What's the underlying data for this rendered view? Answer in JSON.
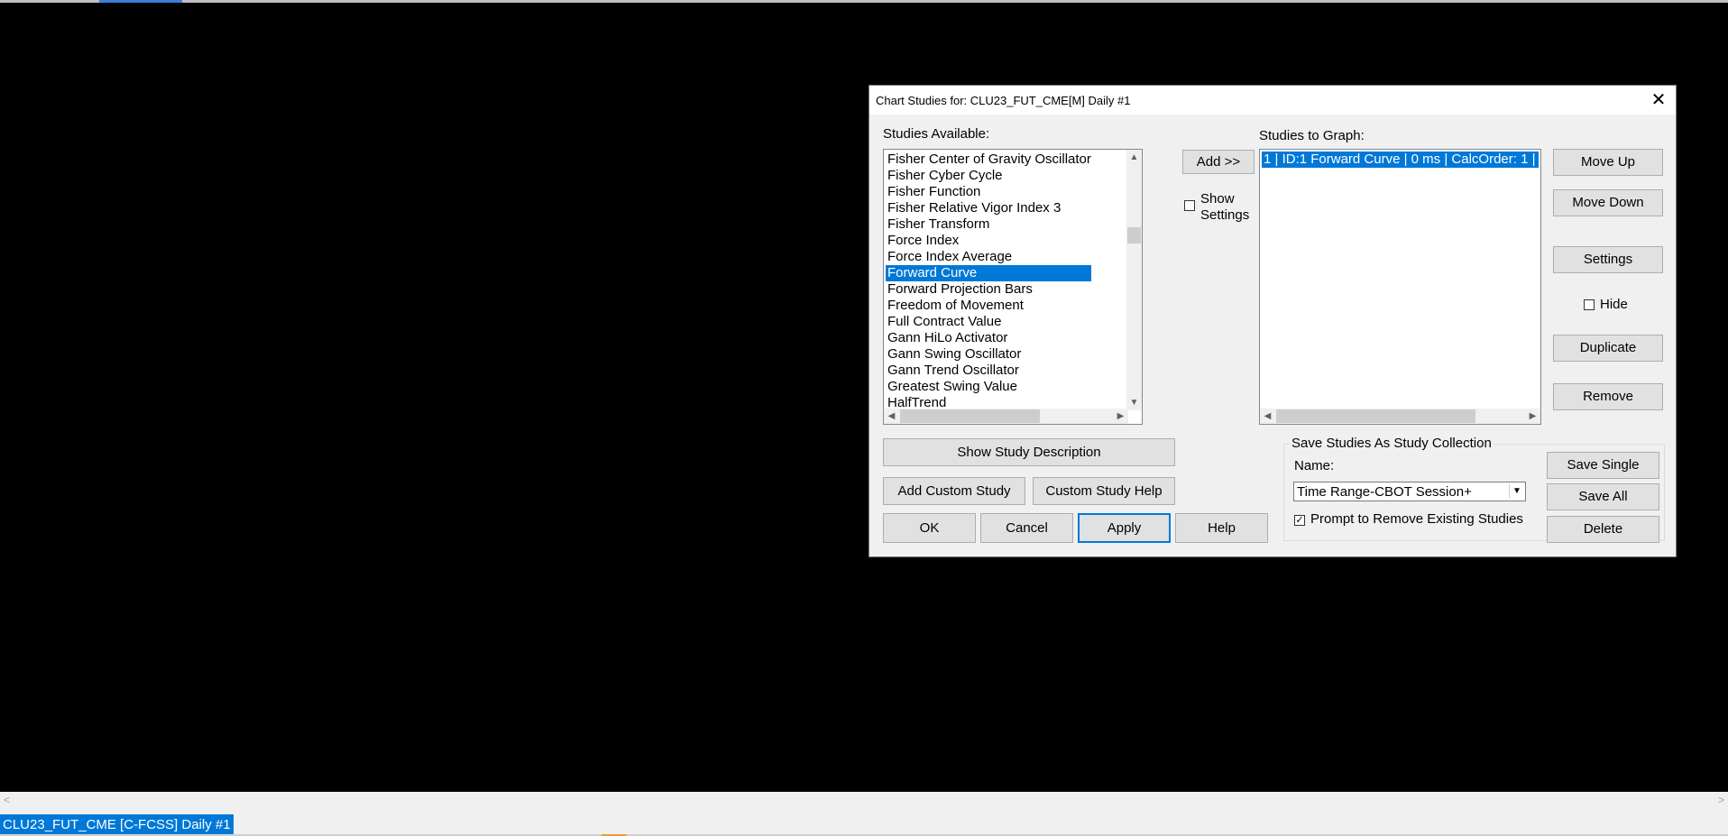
{
  "dialog": {
    "title": "Chart Studies for: CLU23_FUT_CME[M]  Daily #1",
    "close_glyph": "✕"
  },
  "available": {
    "label": "Studies Available:",
    "items": [
      "Fisher Center of Gravity Oscillator",
      "Fisher Cyber Cycle",
      "Fisher Function",
      "Fisher Relative Vigor Index 3",
      "Fisher Transform",
      "Force Index",
      "Force Index Average",
      "Forward Curve",
      "Forward Projection Bars",
      "Freedom of Movement",
      "Full Contract Value",
      "Gann HiLo Activator",
      "Gann Swing Oscillator",
      "Gann Trend Oscillator",
      "Greatest Swing Value",
      "HalfTrend"
    ],
    "selected": "Forward Curve"
  },
  "add_button": "Add >>",
  "show_settings": {
    "line1": "Show",
    "line2": "Settings"
  },
  "graph": {
    "label": "Studies to Graph:",
    "items": [
      "1 | ID:1  Forward Curve | 0 ms | CalcOrder: 1 |"
    ]
  },
  "buttons": {
    "move_up": "Move Up",
    "move_down": "Move Down",
    "settings": "Settings",
    "hide": "Hide",
    "duplicate": "Duplicate",
    "remove": "Remove",
    "show_desc": "Show Study Description",
    "add_custom": "Add Custom Study",
    "custom_help": "Custom Study Help",
    "ok": "OK",
    "cancel": "Cancel",
    "apply": "Apply",
    "help": "Help",
    "save_single": "Save Single",
    "save_all": "Save All",
    "delete": "Delete"
  },
  "collection": {
    "legend": "Save Studies As Study Collection",
    "name_label": "Name:",
    "name_value": "Time Range-CBOT Session+",
    "prompt_label": "Prompt to Remove Existing Studies",
    "prompt_checked": true
  },
  "bottom": {
    "tab": "CLU23_FUT_CME [C-FCSS]  Daily #1"
  }
}
